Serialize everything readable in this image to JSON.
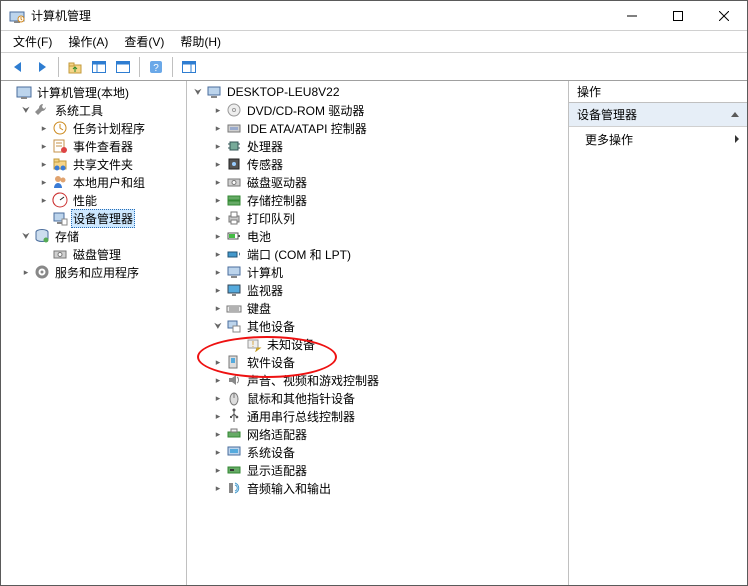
{
  "window": {
    "title": "计算机管理"
  },
  "menu": {
    "file": "文件(F)",
    "action": "操作(A)",
    "view": "查看(V)",
    "help": "帮助(H)"
  },
  "left_tree": {
    "root": "计算机管理(本地)",
    "system_tools": "系统工具",
    "task_scheduler": "任务计划程序",
    "event_viewer": "事件查看器",
    "shared_folders": "共享文件夹",
    "local_users": "本地用户和组",
    "performance": "性能",
    "device_manager": "设备管理器",
    "storage": "存储",
    "disk_mgmt": "磁盘管理",
    "services_apps": "服务和应用程序"
  },
  "device_tree": {
    "root": "DESKTOP-LEU8V22",
    "dvd": "DVD/CD-ROM 驱动器",
    "ide": "IDE ATA/ATAPI 控制器",
    "cpu": "处理器",
    "sensors": "传感器",
    "diskdrives": "磁盘驱动器",
    "storage_ctrl": "存储控制器",
    "print_queue": "打印队列",
    "battery": "电池",
    "ports": "端口 (COM 和 LPT)",
    "computers": "计算机",
    "monitors": "监视器",
    "keyboards": "键盘",
    "other_devices": "其他设备",
    "unknown_device": "未知设备",
    "software_dev": "软件设备",
    "sound": "声音、视频和游戏控制器",
    "mouse": "鼠标和其他指针设备",
    "usb": "通用串行总线控制器",
    "network": "网络适配器",
    "system_dev": "系统设备",
    "display": "显示适配器",
    "audio_io": "音频输入和输出"
  },
  "actions": {
    "header": "操作",
    "title": "设备管理器",
    "more": "更多操作"
  }
}
